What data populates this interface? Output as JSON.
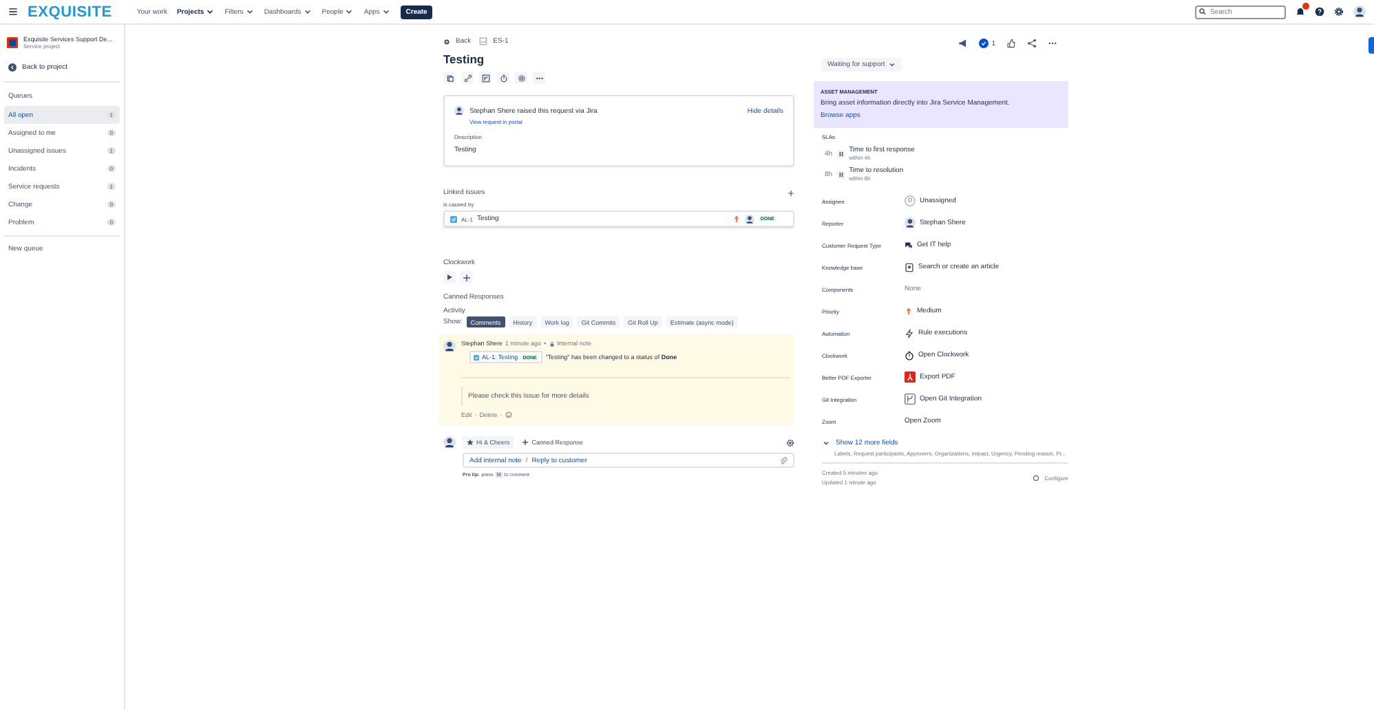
{
  "topbar": {
    "logo": "EXQUISITE",
    "nav": [
      {
        "label": "Your work",
        "dropdown": false
      },
      {
        "label": "Projects",
        "dropdown": true,
        "selected": true
      },
      {
        "label": "Filters",
        "dropdown": true,
        "selected": false
      },
      {
        "label": "Dashboards",
        "dropdown": true,
        "selected": false
      },
      {
        "label": "People",
        "dropdown": true,
        "selected": false
      },
      {
        "label": "Apps",
        "dropdown": true,
        "selected": false
      }
    ],
    "create": "Create",
    "search": {
      "placeholder": "Search"
    }
  },
  "sidebar": {
    "project": "Exquisite Services Support De...",
    "project_type": "Service project",
    "back": "Back to project",
    "section": "Queues",
    "items": [
      {
        "label": "All open",
        "count": "1",
        "selected": true
      },
      {
        "label": "Assigned to me",
        "count": "0",
        "selected": false
      },
      {
        "label": "Unassigned issues",
        "count": "1",
        "selected": false
      },
      {
        "label": "Incidents",
        "count": "0",
        "selected": false
      },
      {
        "label": "Service requests",
        "count": "1",
        "selected": false
      },
      {
        "label": "Change",
        "count": "0",
        "selected": false
      },
      {
        "label": "Problem",
        "count": "0",
        "selected": false
      }
    ],
    "new_queue": "New queue"
  },
  "issue": {
    "back": "Back",
    "key": "ES-1",
    "title": "Testing",
    "request": {
      "text": "Stephan Shere raised this request via Jira",
      "portal_link": "View request in portal",
      "hide": "Hide details",
      "description_label": "Description",
      "description": "Testing"
    },
    "linked": {
      "title": "Linked issues",
      "relation": "is caused by",
      "items": [
        {
          "key": "AL-1",
          "summary": "Testing",
          "status": "DONE"
        }
      ]
    },
    "clockwork": "Clockwork",
    "canned": "Canned Responses",
    "activity": "Activity",
    "show_label": "Show:",
    "tabs": [
      {
        "label": "Comments",
        "selected": true
      },
      {
        "label": "History",
        "selected": false
      },
      {
        "label": "Work log",
        "selected": false
      },
      {
        "label": "Git Commits",
        "selected": false
      },
      {
        "label": "Git Roll Up",
        "selected": false
      },
      {
        "label": "Estimate (async mode)",
        "selected": false
      }
    ],
    "comment": {
      "author": "Stephan Shere",
      "time": "1 minute ago",
      "sep": "•",
      "visibility": "Internal note",
      "chip_key": "AL-1: Testing",
      "chip_status": "DONE",
      "change": "\"Testing\" has been changed to a status of **Done**",
      "body": "Please check this issue for more details",
      "actions": [
        "Edit",
        "Delete"
      ],
      "action_sep": "·"
    },
    "compose": {
      "template": "Hi & Cheers",
      "canned": "Canned Response",
      "internal": "Add internal note",
      "slash": "/",
      "reply": "Reply to customer",
      "tip": "Pro tip:",
      "tip_press": "press",
      "tip_key": "M",
      "tip_end": "to comment"
    }
  },
  "details": {
    "watchers": "1",
    "status": "Waiting for support",
    "asset": {
      "title": "ASSET MANAGEMENT",
      "text": "Bring asset information directly into Jira Service Management.",
      "link": "Browse apps"
    },
    "slas_label": "SLAs",
    "slas": [
      {
        "time": "4h",
        "name": "Time to first response",
        "goal": "within 4h"
      },
      {
        "time": "8h",
        "name": "Time to resolution",
        "goal": "within 8h"
      }
    ],
    "fields": [
      {
        "label": "Assignee",
        "value": "Unassigned",
        "kind": "unassigned"
      },
      {
        "label": "Reporter",
        "value": "Stephan Shere",
        "kind": "user"
      },
      {
        "label": "Customer Request Type",
        "value": "Get IT help",
        "kind": "request"
      },
      {
        "label": "Knowledge base",
        "value": "Search or create an article",
        "kind": "article"
      },
      {
        "label": "Components",
        "value": "None",
        "kind": "none"
      },
      {
        "label": "Priority",
        "value": "Medium",
        "kind": "priority"
      },
      {
        "label": "Automation",
        "value": "Rule executions",
        "kind": "automation"
      },
      {
        "label": "Clockwork",
        "value": "Open Clockwork",
        "kind": "clock"
      },
      {
        "label": "Better PDF Exporter",
        "value": "Export PDF",
        "kind": "pdf"
      },
      {
        "label": "Git Integration",
        "value": "Open Git Integration",
        "kind": "git"
      },
      {
        "label": "Zoom",
        "value": "Open Zoom",
        "kind": "plain"
      }
    ],
    "more": "Show 12 more fields",
    "more_sub": "Labels, Request participants, Approvers, Organizations, Impact, Urgency, Pending reason, Pr...",
    "created": "Created 5 minutes ago",
    "updated": "Updated 1 minute ago",
    "configure": "Configure"
  }
}
